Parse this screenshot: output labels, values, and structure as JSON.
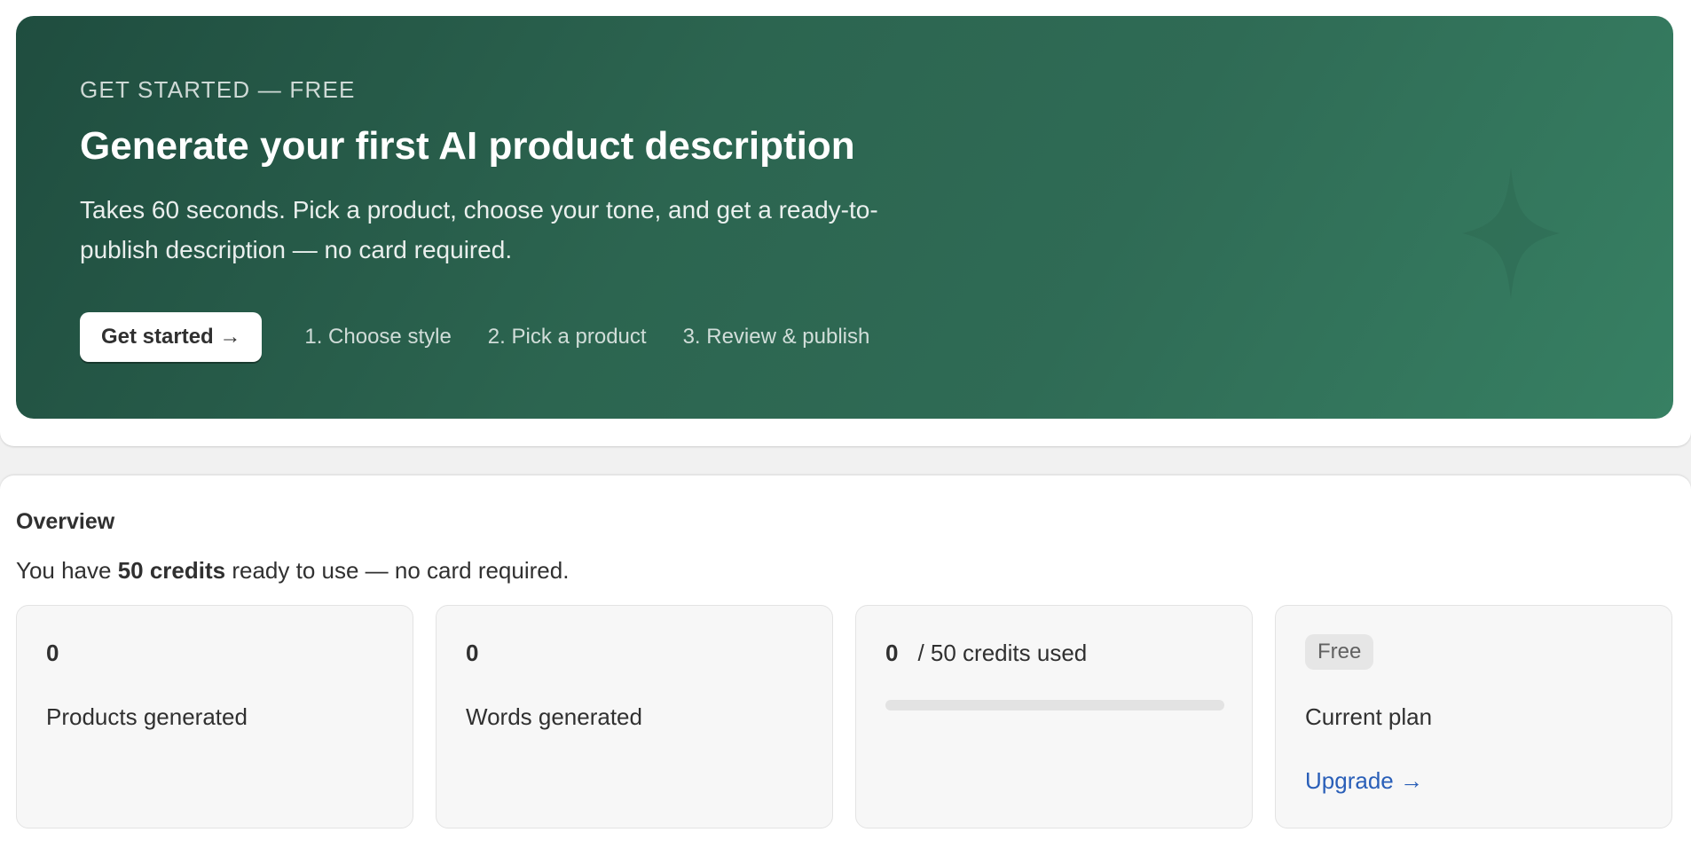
{
  "hero": {
    "eyebrow": "GET STARTED — FREE",
    "title": "Generate your first AI product description",
    "description": "Takes 60 seconds. Pick a product, choose your tone, and get a ready-to-publish description — no card required.",
    "cta_label": "Get started →",
    "steps": [
      "1. Choose style",
      "2. Pick a product",
      "3. Review & publish"
    ],
    "decor_icon": "sparkle-icon"
  },
  "overview": {
    "title": "Overview",
    "subtitle_prefix": "You have ",
    "subtitle_bold": "50 credits",
    "subtitle_suffix": " ready to use — no card required.",
    "stats": [
      {
        "value": "0",
        "label": "Products generated"
      },
      {
        "value": "0",
        "label": "Words generated"
      }
    ],
    "credits": {
      "used": "0",
      "total_label": "/ 50 credits used",
      "used_fraction": 0
    },
    "plan": {
      "badge": "Free",
      "label": "Current plan",
      "upgrade_label": "Upgrade →"
    }
  },
  "colors": {
    "hero_gradient_start": "#1f4d3f",
    "hero_gradient_end": "#378063",
    "link": "#2a5fb8",
    "card_bg": "#f7f7f7"
  }
}
